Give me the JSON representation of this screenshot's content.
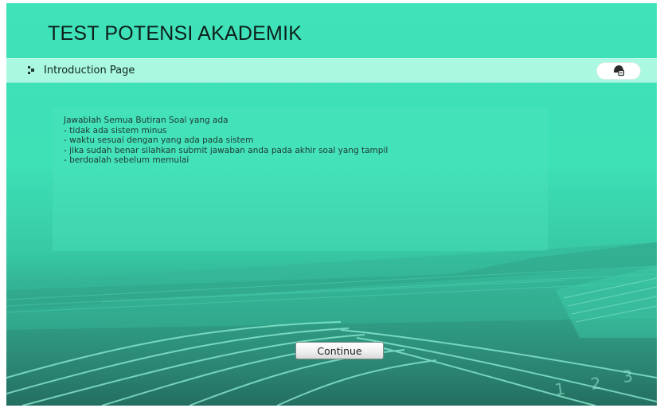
{
  "header": {
    "title": "TEST POTENSI AKADEMIK"
  },
  "nav_bar": {
    "title": "Introduction Page",
    "bullet_icon": "bullet-icon",
    "help_icon": "helmet-icon"
  },
  "intro": {
    "lines": [
      "Jawablah Semua Butiran Soal yang ada",
      "- tidak ada sistem minus",
      "- waktu sesuai dengan yang ada pada sistem",
      "- jika sudah benar silahkan submit jawaban anda pada akhir soal yang tampil",
      "- berdoalah sebelum memulai"
    ]
  },
  "actions": {
    "continue_label": "Continue"
  },
  "colors": {
    "accent": "#3fe3b9",
    "bar": "#aaf7e2"
  }
}
